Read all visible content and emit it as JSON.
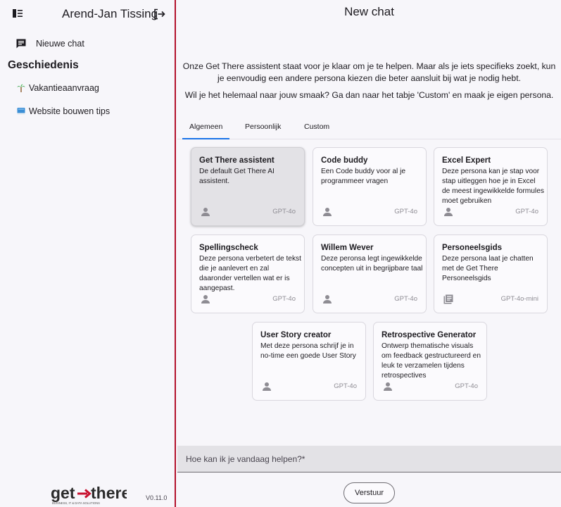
{
  "sidebar": {
    "user_name": "Arend-Jan Tissing",
    "new_chat_label": "Nieuwe chat",
    "history_title": "Geschiedenis",
    "history": [
      {
        "emoji": "palm-tree",
        "label": "Vakantieaanvraag"
      },
      {
        "emoji": "book",
        "label": "Website bouwen tips"
      }
    ],
    "logo_text": "get→there",
    "logo_tagline": "BUSINESS, IT & DATA SOLUTIONS",
    "version": "V0.11.0"
  },
  "main": {
    "title": "New chat",
    "intro_line1": "Onze Get There assistent staat voor je klaar om je te helpen. Maar als je iets specifieks zoekt, kun je eenvoudig een andere persona kiezen die beter aansluit bij wat je nodig hebt.",
    "intro_line2": "Wil je het helemaal naar jouw smaak? Ga dan naar het tabje 'Custom' en maak je eigen persona.",
    "tabs": [
      "Algemeen",
      "Persoonlijk",
      "Custom"
    ],
    "active_tab": "Algemeen",
    "personas": [
      {
        "title": "Get There assistent",
        "desc": "De default Get There AI assistent.",
        "model": "GPT-4o",
        "icon": "person-icon",
        "selected": true
      },
      {
        "title": "Code buddy",
        "desc": "Een Code buddy voor al je programmeer vragen",
        "model": "GPT-4o",
        "icon": "person-icon"
      },
      {
        "title": "Excel Expert",
        "desc": "Deze persona kan je stap voor stap uitleggen hoe je in Excel de meest ingewikkelde formules moet gebruiken",
        "model": "GPT-4o",
        "icon": "person-icon"
      },
      {
        "title": "Spellingscheck",
        "desc": "Deze persona verbetert de tekst die je aanlevert en zal daaronder vertellen wat er is aangepast.",
        "model": "GPT-4o",
        "icon": "person-icon"
      },
      {
        "title": "Willem Wever",
        "desc": "Deze peronsa legt ingewikkelde concepten uit in begrijpbare taal",
        "model": "GPT-4o",
        "icon": "person-icon"
      },
      {
        "title": "Personeelsgids",
        "desc": "Deze persona laat je chatten met de Get There Personeelsgids",
        "model": "GPT-4o-mini",
        "icon": "library-icon"
      },
      {
        "title": "User Story creator",
        "desc": "Met deze persona schrijf je in no-time een goede User Story",
        "model": "GPT-4o",
        "icon": "person-icon"
      },
      {
        "title": "Retrospective Generator",
        "desc": "Ontwerp thematische visuals om feedback gestructureerd en leuk te verzamelen tijdens retrospectives",
        "model": "GPT-4o",
        "icon": "person-icon"
      }
    ],
    "input_placeholder": "Hoe kan ik je vandaag helpen?*",
    "send_label": "Verstuur"
  },
  "colors": {
    "accent": "#1a73e8",
    "divider": "#b3122c",
    "logo_arrow": "#c8102e"
  }
}
